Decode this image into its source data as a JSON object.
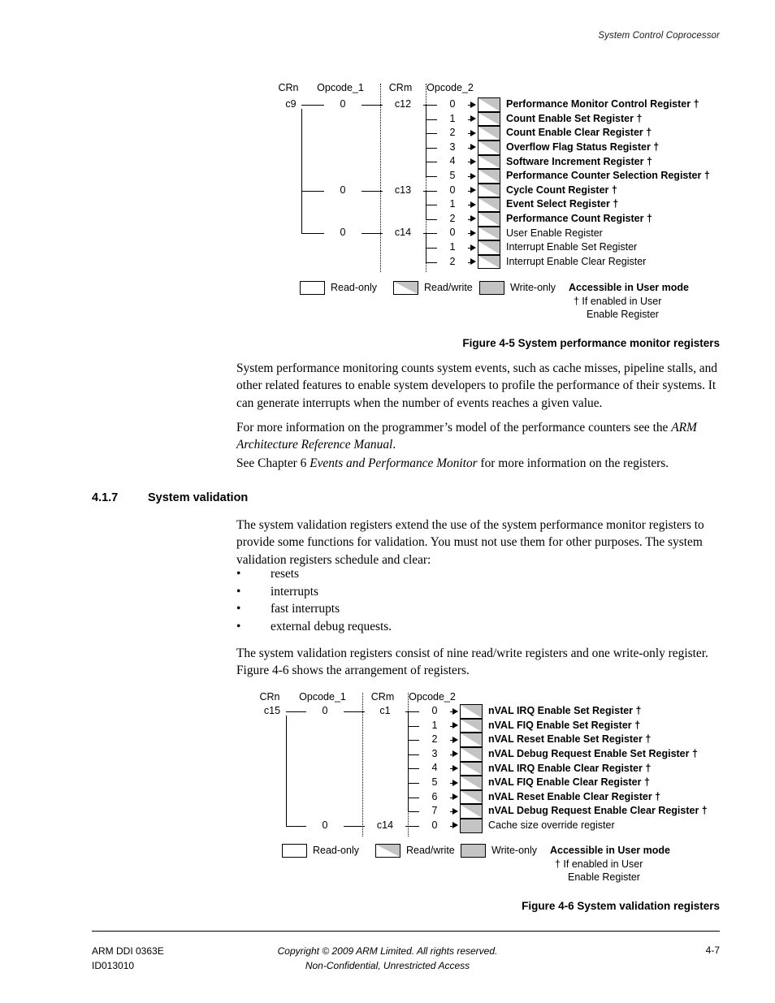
{
  "header": {
    "running_head": "System Control Coprocessor"
  },
  "figure_4_5": {
    "columns": [
      "CRn",
      "Opcode_1",
      "CRm",
      "Opcode_2"
    ],
    "crn": "c9",
    "groups": [
      {
        "opcode_1": "0",
        "crm": "c12",
        "rows": [
          {
            "opcode_2": "0",
            "access": "rw",
            "label": "Performance Monitor Control Register †",
            "bold": true
          },
          {
            "opcode_2": "1",
            "access": "rw",
            "label": "Count Enable Set Register †",
            "bold": true
          },
          {
            "opcode_2": "2",
            "access": "rw",
            "label": "Count Enable Clear Register †",
            "bold": true
          },
          {
            "opcode_2": "3",
            "access": "rw",
            "label": "Overflow Flag Status Register †",
            "bold": true
          },
          {
            "opcode_2": "4",
            "access": "rw",
            "label": "Software Increment Register †",
            "bold": true
          },
          {
            "opcode_2": "5",
            "access": "rw",
            "label": "Performance Counter Selection Register †",
            "bold": true
          }
        ]
      },
      {
        "opcode_1": "0",
        "crm": "c13",
        "rows": [
          {
            "opcode_2": "0",
            "access": "rw",
            "label": "Cycle Count Register †",
            "bold": true
          },
          {
            "opcode_2": "1",
            "access": "rw",
            "label": "Event Select Register †",
            "bold": true
          },
          {
            "opcode_2": "2",
            "access": "rw",
            "label": "Performance Count Register †",
            "bold": true
          }
        ]
      },
      {
        "opcode_1": "0",
        "crm": "c14",
        "rows": [
          {
            "opcode_2": "0",
            "access": "rw",
            "label": "User Enable Register",
            "bold": false
          },
          {
            "opcode_2": "1",
            "access": "rw",
            "label": "Interrupt Enable Set Register",
            "bold": false
          },
          {
            "opcode_2": "2",
            "access": "rw",
            "label": "Interrupt Enable Clear Register",
            "bold": false
          }
        ]
      }
    ],
    "legend": {
      "read_only": "Read-only",
      "read_write": "Read/write",
      "write_only": "Write-only",
      "user_mode": "Accessible in User mode",
      "dagger_line1": "† If enabled in User",
      "dagger_line2": "Enable Register"
    },
    "caption": "Figure 4-5 System performance monitor registers"
  },
  "figure_4_6": {
    "columns": [
      "CRn",
      "Opcode_1",
      "CRm",
      "Opcode_2"
    ],
    "crn": "c15",
    "groups": [
      {
        "opcode_1": "0",
        "crm": "c1",
        "rows": [
          {
            "opcode_2": "0",
            "access": "rw",
            "label": "nVAL IRQ Enable Set Register †",
            "bold": true
          },
          {
            "opcode_2": "1",
            "access": "rw",
            "label": "nVAL FIQ Enable Set Register †",
            "bold": true
          },
          {
            "opcode_2": "2",
            "access": "rw",
            "label": "nVAL Reset Enable Set Register †",
            "bold": true
          },
          {
            "opcode_2": "3",
            "access": "rw",
            "label": "nVAL Debug Request Enable Set Register †",
            "bold": true
          },
          {
            "opcode_2": "4",
            "access": "rw",
            "label": "nVAL IRQ Enable Clear Register †",
            "bold": true
          },
          {
            "opcode_2": "5",
            "access": "rw",
            "label": "nVAL FIQ Enable Clear Register †",
            "bold": true
          },
          {
            "opcode_2": "6",
            "access": "rw",
            "label": "nVAL Reset Enable Clear Register †",
            "bold": true
          },
          {
            "opcode_2": "7",
            "access": "rw",
            "label": "nVAL Debug Request Enable Clear Register †",
            "bold": true
          }
        ]
      },
      {
        "opcode_1": "0",
        "crm": "c14",
        "rows": [
          {
            "opcode_2": "0",
            "access": "wo",
            "label": "Cache size override register",
            "bold": false
          }
        ]
      }
    ],
    "legend": {
      "read_only": "Read-only",
      "read_write": "Read/write",
      "write_only": "Write-only",
      "user_mode": "Accessible in User mode",
      "dagger_line1": "† If enabled in User",
      "dagger_line2": "Enable Register"
    },
    "caption": "Figure 4-6 System validation registers"
  },
  "body": {
    "para1": "System performance monitoring counts system events, such as cache misses, pipeline stalls, and other related features to enable system developers to profile the performance of their systems. It can generate interrupts when the number of events reaches a given value.",
    "para2_pre": "For more information on the programmer’s model of the performance counters see the ",
    "para2_em": "ARM Architecture Reference Manual",
    "para2_post": ".",
    "para3_pre": "See Chapter 6 ",
    "para3_em": "Events and Performance Monitor",
    "para3_post": " for more information on the registers.",
    "section_number": "4.1.7",
    "section_title": "System validation",
    "para4": "The system validation registers extend the use of the system performance monitor registers to provide some functions for validation. You must not use them for other purposes. The system validation registers schedule and clear:",
    "bullets": [
      "resets",
      "interrupts",
      "fast interrupts",
      "external debug requests."
    ],
    "para5": "The system validation registers consist of nine read/write registers and one write-only register. Figure 4-6 shows the arrangement of registers."
  },
  "footer": {
    "doc_id": "ARM DDI 0363E",
    "doc_rev": "ID013010",
    "copyright": "Copyright © 2009 ARM Limited. All rights reserved.",
    "confidentiality": "Non-Confidential, Unrestricted Access",
    "page_number": "4-7"
  }
}
